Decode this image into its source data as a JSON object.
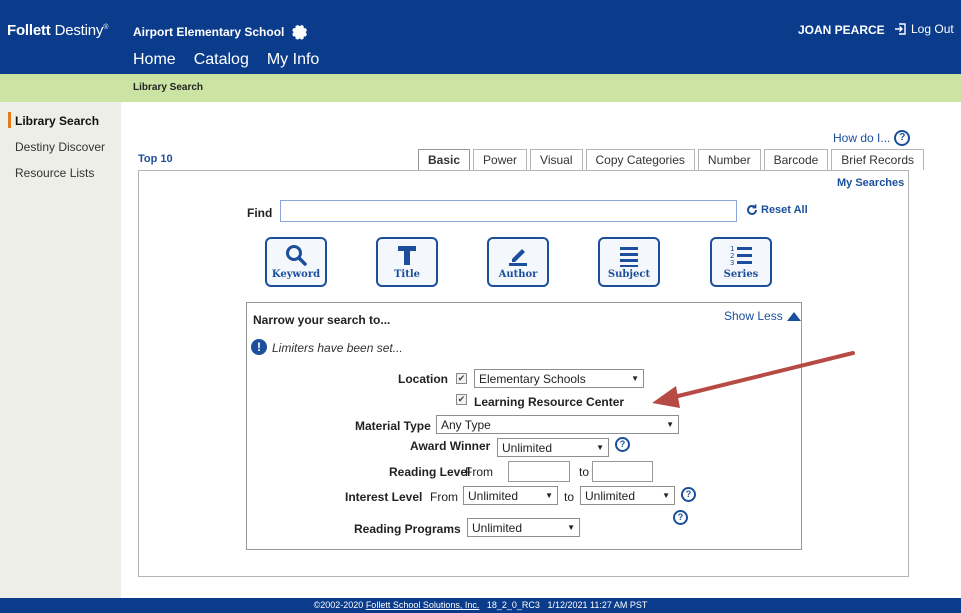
{
  "header": {
    "logo_bold": "Follett",
    "logo_light": "Destiny",
    "logo_reg": "®",
    "school": "Airport Elementary School",
    "user": "JOAN PEARCE",
    "logout": "Log Out",
    "nav": [
      "Home",
      "Catalog",
      "My Info"
    ]
  },
  "breadcrumb": "Library Search",
  "sidebar": {
    "items": [
      "Library Search",
      "Destiny Discover",
      "Resource Lists"
    ]
  },
  "main": {
    "howdo": "How do I...",
    "top10": "Top 10",
    "tabs": [
      "Basic",
      "Power",
      "Visual",
      "Copy Categories",
      "Number",
      "Barcode",
      "Brief Records"
    ],
    "my_searches": "My Searches",
    "find_label": "Find",
    "find_value": "",
    "reset_all": "Reset All",
    "search_buttons": [
      "Keyword",
      "Title",
      "Author",
      "Subject",
      "Series"
    ]
  },
  "narrow": {
    "title": "Narrow your search to...",
    "show_less": "Show Less",
    "limiters_msg": "Limiters have been set...",
    "location_label": "Location",
    "location_value": "Elementary Schools",
    "lrc_label": "Learning Resource Center",
    "material_type_label": "Material Type",
    "material_type_value": "Any Type",
    "award_label": "Award Winner",
    "award_value": "Unlimited",
    "reading_level_label": "Reading Level",
    "from": "From",
    "to": "to",
    "interest_level_label": "Interest Level",
    "interest_from_value": "Unlimited",
    "interest_to_value": "Unlimited",
    "reading_programs_label": "Reading Programs",
    "reading_programs_value": "Unlimited"
  },
  "footer": {
    "copyright_prefix": "©2002-2020",
    "company": "Follett School Solutions, Inc.",
    "version": "18_2_0_RC3",
    "timestamp": "1/12/2021 11:27 AM PST"
  },
  "colors": {
    "header_bg": "#0b3c8c",
    "nav_active": "#f0922b",
    "breadcrumb_bg": "#cbe4a4",
    "link": "#1b4f9c",
    "arrow": "#b84a45"
  }
}
